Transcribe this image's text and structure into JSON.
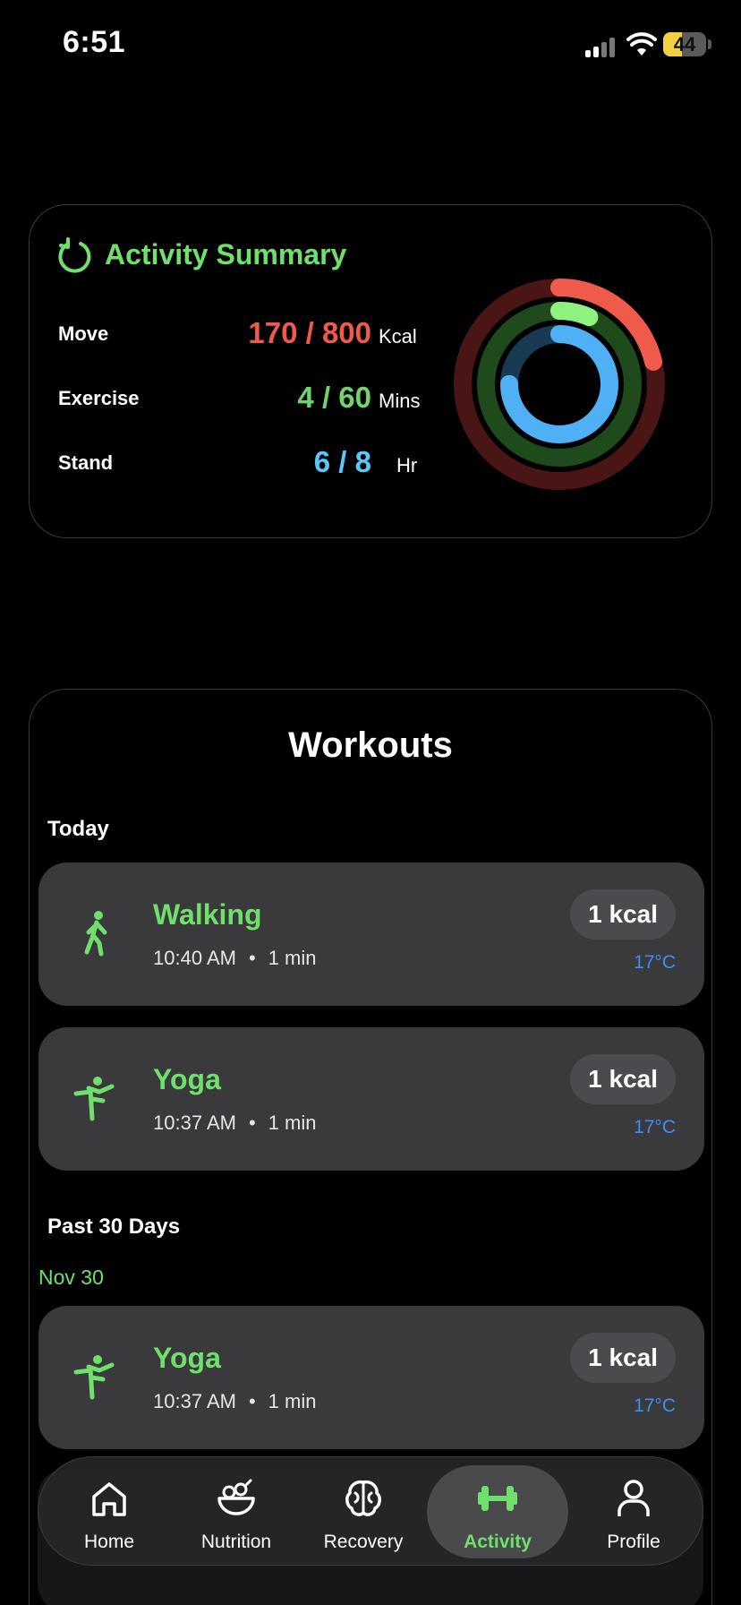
{
  "status_bar": {
    "time": "6:51",
    "battery_percent": "44",
    "battery_level": 0.44
  },
  "activity_summary": {
    "title": "Activity Summary",
    "metrics": [
      {
        "label": "Move",
        "value": "170 / 800",
        "unit": "Kcal",
        "color": "#ef5a4b",
        "progress": 0.2125
      },
      {
        "label": "Exercise",
        "value": "4 / 60",
        "unit": "Mins",
        "color": "#6ed66a",
        "progress": 0.0667
      },
      {
        "label": "Stand",
        "value": "6 / 8",
        "unit": "Hr",
        "color": "#5ac8fa",
        "progress": 0.75
      }
    ]
  },
  "workouts": {
    "title": "Workouts",
    "today_label": "Today",
    "past_label": "Past 30 Days",
    "past_date": "Nov 30",
    "items": [
      {
        "name": "Walking",
        "time": "10:40 AM",
        "duration": "1 min",
        "kcal": "1 kcal",
        "temp": "17°C",
        "icon": "walking-icon"
      },
      {
        "name": "Yoga",
        "time": "10:37 AM",
        "duration": "1 min",
        "kcal": "1 kcal",
        "temp": "17°C",
        "icon": "yoga-icon"
      },
      {
        "name": "Yoga",
        "time": "10:37 AM",
        "duration": "1 min",
        "kcal": "1 kcal",
        "temp": "17°C",
        "icon": "yoga-icon"
      }
    ]
  },
  "tab_bar": {
    "tabs": [
      {
        "label": "Home",
        "icon": "home-icon"
      },
      {
        "label": "Nutrition",
        "icon": "salad-bowl-icon"
      },
      {
        "label": "Recovery",
        "icon": "brain-icon"
      },
      {
        "label": "Activity",
        "icon": "dumbbell-icon",
        "active": true
      },
      {
        "label": "Profile",
        "icon": "person-icon"
      }
    ]
  },
  "colors": {
    "accent": "#6ee06b",
    "temperature": "#3d8ff5",
    "card": "#3a3a3c"
  }
}
